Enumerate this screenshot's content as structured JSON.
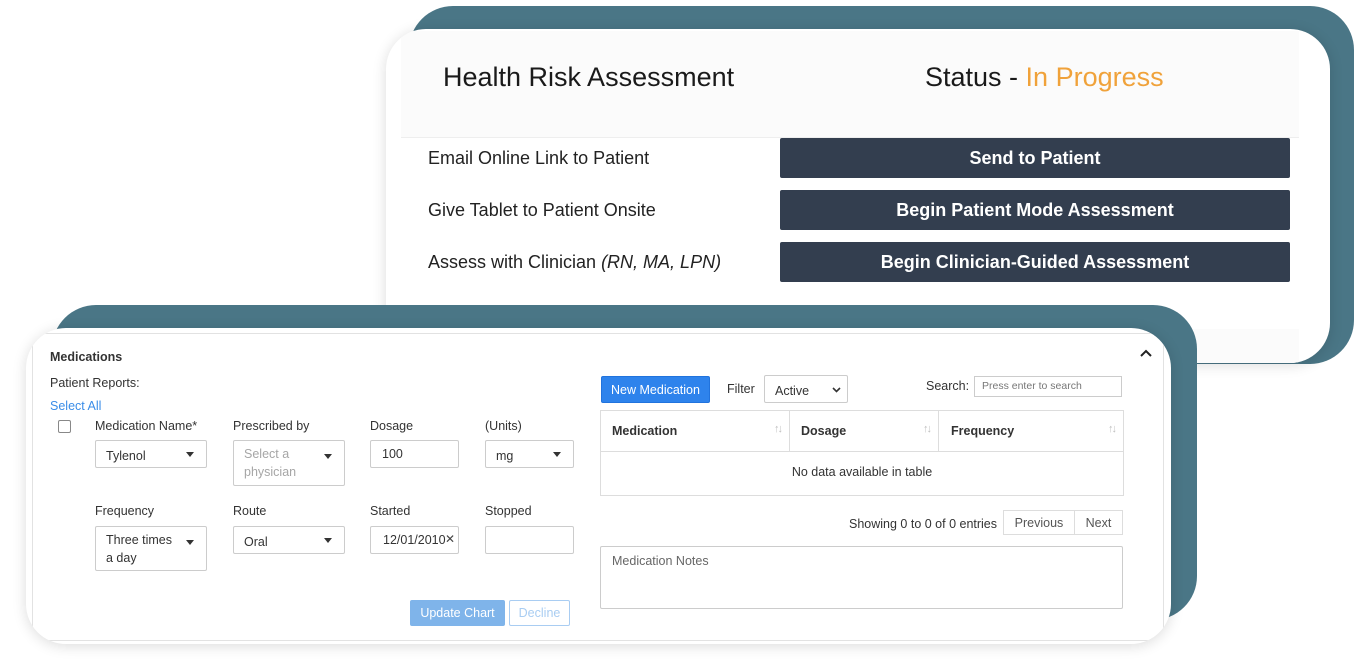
{
  "hra": {
    "title": "Health Risk Assessment",
    "status_label": "Status - ",
    "status_value": "In Progress",
    "status_color": "#f0a23a",
    "button_color": "#333e4f",
    "rows": [
      {
        "label": "Email Online Link to Patient",
        "label_italic": "",
        "button": "Send to Patient"
      },
      {
        "label": "Give Tablet to Patient Onsite",
        "label_italic": "",
        "button": "Begin Patient Mode Assessment"
      },
      {
        "label": "Assess with Clinician ",
        "label_italic": "(RN, MA, LPN)",
        "button": "Begin Clinician-Guided Assessment"
      }
    ]
  },
  "medications": {
    "title": "Medications",
    "collapse_icon": "chevron-up-icon",
    "patient_reports_label": "Patient Reports:",
    "select_all_label": "Select All",
    "form": {
      "medication_name_label": "Medication Name*",
      "medication_name_value": "Tylenol",
      "prescribed_by_label": "Prescribed by",
      "prescribed_by_placeholder_1": "Select a",
      "prescribed_by_placeholder_2": "physician",
      "dosage_label": "Dosage",
      "dosage_value": "100",
      "units_label": "(Units)",
      "units_value": "mg",
      "frequency_label": "Frequency",
      "frequency_value_1": "Three times",
      "frequency_value_2": "a day",
      "route_label": "Route",
      "route_value": "Oral",
      "started_label": "Started",
      "started_value": "12/01/2010",
      "stopped_label": "Stopped",
      "stopped_value": ""
    },
    "update_button": "Update Chart",
    "decline_button": "Decline",
    "new_medication_button": "New Medication",
    "filter_label": "Filter",
    "filter_value": "Active",
    "search_label": "Search:",
    "search_placeholder": "Press enter to search",
    "table": {
      "columns": [
        "Medication",
        "Dosage",
        "Frequency"
      ],
      "empty_message": "No data available in table"
    },
    "info_text": "Showing 0 to 0 of 0 entries",
    "previous_button": "Previous",
    "next_button": "Next",
    "notes_placeholder": "Medication Notes",
    "accent_color": "#2e83ec"
  }
}
